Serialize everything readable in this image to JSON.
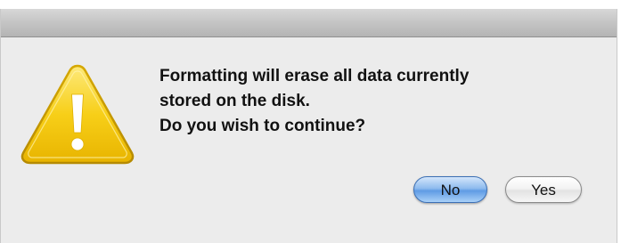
{
  "dialog": {
    "message_lines": [
      "Formatting will erase all data currently",
      "stored on the disk.",
      "Do you wish to continue?"
    ],
    "icon": "warning-icon",
    "buttons": {
      "no_label": "No",
      "yes_label": "Yes",
      "default_button": "No"
    }
  },
  "colors": {
    "default_button_accent": "#5f9be4",
    "warning_yellow": "#f5c400",
    "dialog_background": "#ececec"
  }
}
